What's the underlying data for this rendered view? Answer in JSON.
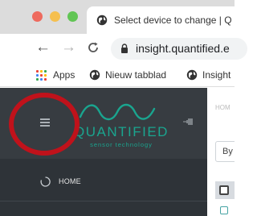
{
  "browser": {
    "window_controls": [
      "close",
      "minimize",
      "zoom"
    ],
    "tab": {
      "title": "Select device to change | Q",
      "icon": "globe-icon"
    },
    "nav": {
      "back": "←",
      "forward": "→",
      "reload": "C"
    },
    "address": {
      "url": "insight.quantified.e",
      "icon": "lock-icon"
    },
    "bookmarks": [
      {
        "label": "Apps",
        "icon": "apps-grid-icon"
      },
      {
        "label": "Nieuw tabblad",
        "icon": "globe-icon"
      },
      {
        "label": "Insight",
        "icon": "globe-icon"
      }
    ]
  },
  "sidebar": {
    "menu_icon": "hamburger-icon",
    "logo_text": "QUANTIFIED",
    "logo_tagline": "sensor technology",
    "pin_icon": "pin-icon",
    "items": [
      {
        "label": "HOME",
        "icon": "circle-icon"
      }
    ]
  },
  "main": {
    "breadcrumb": "HOM",
    "filter_label": "By"
  },
  "colors": {
    "sidebar_bg": "#2e3338",
    "sidebar_header_bg": "#373c41",
    "logo_accent": "#1aa58f",
    "annotation": "#c0121b"
  }
}
